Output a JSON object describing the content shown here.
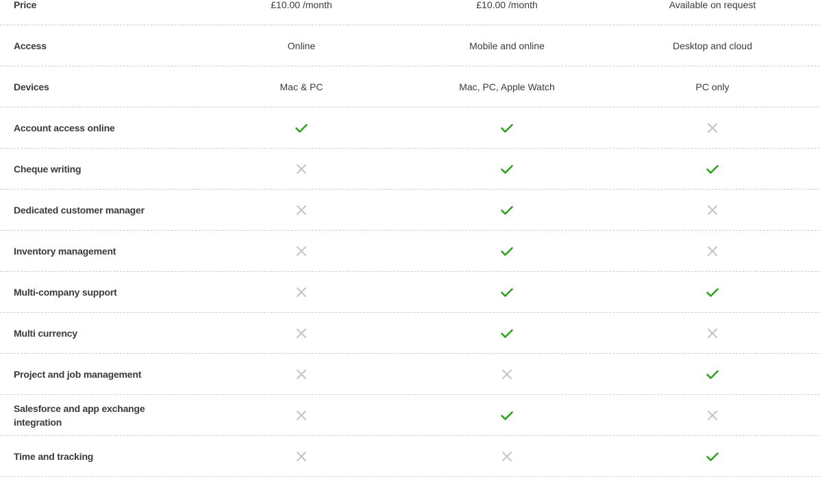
{
  "colors": {
    "check": "#2ca01c",
    "cross": "#c1c4c8",
    "text": "#393a3d",
    "divider": "#c9ccd1"
  },
  "rows": [
    {
      "feature": "Price",
      "values": [
        "£10.00 /month",
        "£10.00 /month",
        "Available on request"
      ]
    },
    {
      "feature": "Access",
      "values": [
        "Online",
        "Mobile and online",
        "Desktop and cloud"
      ]
    },
    {
      "feature": "Devices",
      "values": [
        "Mac & PC",
        "Mac, PC, Apple Watch",
        "PC only"
      ]
    },
    {
      "feature": "Account access online",
      "values": [
        "check",
        "check",
        "cross"
      ]
    },
    {
      "feature": "Cheque writing",
      "values": [
        "cross",
        "check",
        "check"
      ]
    },
    {
      "feature": "Dedicated customer manager",
      "values": [
        "cross",
        "check",
        "cross"
      ]
    },
    {
      "feature": "Inventory management",
      "values": [
        "cross",
        "check",
        "cross"
      ]
    },
    {
      "feature": "Multi-company support",
      "values": [
        "cross",
        "check",
        "check"
      ]
    },
    {
      "feature": "Multi currency",
      "values": [
        "cross",
        "check",
        "cross"
      ]
    },
    {
      "feature": "Project and job management",
      "values": [
        "cross",
        "cross",
        "check"
      ]
    },
    {
      "feature": "Salesforce and app exchange integration",
      "values": [
        "cross",
        "check",
        "cross"
      ]
    },
    {
      "feature": "Time and tracking",
      "values": [
        "cross",
        "cross",
        "check"
      ]
    }
  ]
}
